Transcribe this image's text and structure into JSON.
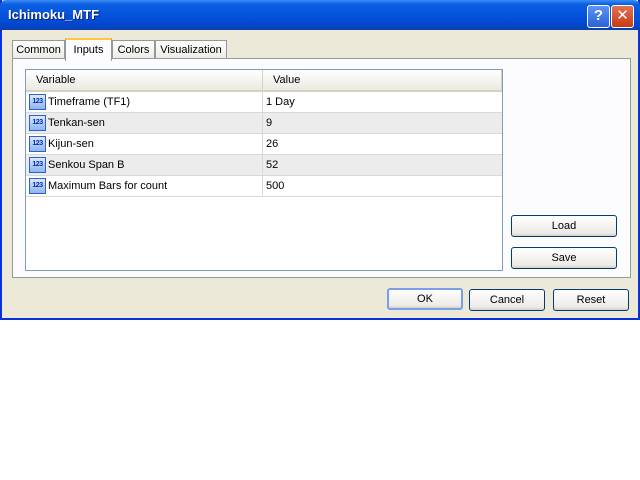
{
  "window": {
    "title": "Ichimoku_MTF",
    "help_glyph": "?",
    "close_glyph": "✕"
  },
  "tabs": [
    {
      "label": "Common"
    },
    {
      "label": "Inputs"
    },
    {
      "label": "Colors"
    },
    {
      "label": "Visualization"
    }
  ],
  "active_tab": "Inputs",
  "grid": {
    "columns": [
      "Variable",
      "Value"
    ],
    "icon_text": "123",
    "rows": [
      {
        "variable": "Timeframe (TF1)",
        "value": "1 Day"
      },
      {
        "variable": "Tenkan-sen",
        "value": "9"
      },
      {
        "variable": "Kijun-sen",
        "value": "26"
      },
      {
        "variable": "Senkou Span B",
        "value": "52"
      },
      {
        "variable": "Maximum Bars for count",
        "value": "500"
      }
    ]
  },
  "side_buttons": {
    "load": "Load",
    "save": "Save"
  },
  "footer_buttons": {
    "ok": "OK",
    "cancel": "Cancel",
    "reset": "Reset"
  },
  "colors": {
    "titlebar": "#0453dc",
    "face": "#ece9d8",
    "active_tab_accent": "#ffc83c"
  }
}
